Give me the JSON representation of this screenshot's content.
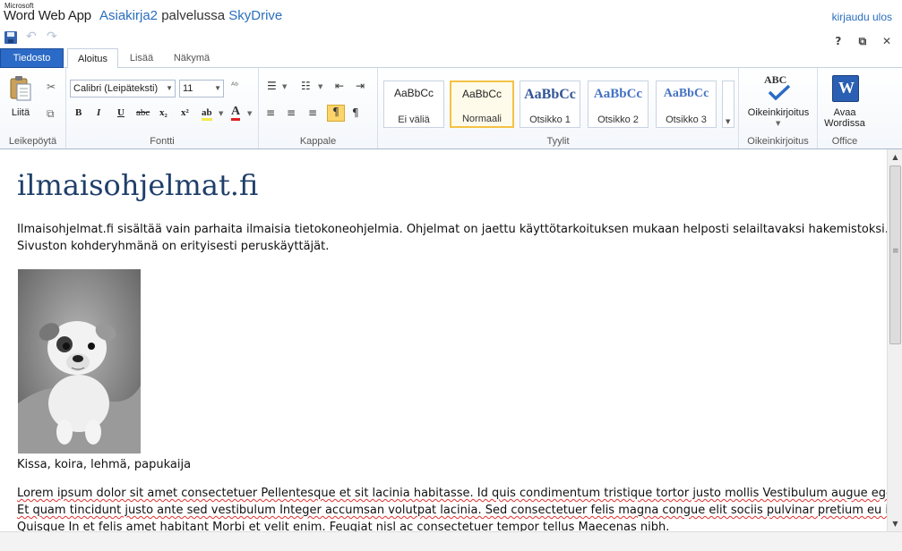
{
  "title_bar": {
    "brand_small": "Microsoft",
    "brand_main": "Word Web App",
    "doc_name": "Asiakirja2",
    "location_prefix": "palvelussa",
    "service": "SkyDrive",
    "signout": "kirjaudu ulos"
  },
  "quick_access": {
    "save_icon": "save-icon",
    "undo_icon": "undo-icon",
    "redo_icon": "redo-icon",
    "help": "?",
    "popout": "⧉",
    "close": "✕"
  },
  "tabs": {
    "file": "Tiedosto",
    "items": [
      "Aloitus",
      "Lisää",
      "Näkymä"
    ],
    "active": "Aloitus"
  },
  "ribbon": {
    "clipboard": {
      "label": "Leikepöytä",
      "paste": "Liitä"
    },
    "font": {
      "label": "Fontti",
      "font_name": "Calibri (Leipäteksti)",
      "font_size": "11",
      "bold": "B",
      "italic": "I",
      "underline": "U",
      "strike": "abc",
      "subscript": "x₂",
      "superscript": "x²",
      "highlight": "ab",
      "font_color": "A"
    },
    "paragraph": {
      "label": "Kappale"
    },
    "styles": {
      "label": "Tyylit",
      "sample": "AaBbCc",
      "items": [
        "Ei väliä",
        "Normaali",
        "Otsikko 1",
        "Otsikko 2",
        "Otsikko 3"
      ],
      "selected": "Normaali"
    },
    "proofing": {
      "label": "Oikeinkirjoitus",
      "button": "Oikeinkirjoitus",
      "icon_text": "ABC"
    },
    "office": {
      "label": "Office",
      "button_line1": "Avaa",
      "button_line2": "Wordissa"
    }
  },
  "document": {
    "heading": "ilmaisohjelmat.fi",
    "para1_line1": "Ilmaisohjelmat.fi sisältää vain parhaita ilmaisia tietokoneohjelmia. Ohjelmat on jaettu käyttötarkoituksen mukaan helposti selailtavaksi hakemistoksi.",
    "para1_line2": "Sivuston kohderyhmänä on erityisesti peruskäyttäjät.",
    "image": "puppy-photo",
    "caption": "Kissa, koira, lehmä, papukaija",
    "lorem_line1": "Lorem ipsum dolor sit amet consectetuer Pellentesque et sit lacinia habitasse. Id quis condimentum tristique tortor justo mollis Vestibulum augue eget Sed.",
    "lorem_line2": "Et quam tincidunt justo ante sed vestibulum Integer accumsan volutpat lacinia. Sed consectetuer felis magna congue elit sociis pulvinar pretium eu in. Pede",
    "lorem_line3": "Quisque In et felis amet habitant Morbi et velit enim. Feugiat nisl ac consectetuer tempor tellus Maecenas nibh."
  },
  "colors": {
    "accent": "#2b6ac6",
    "link": "#2a6ebd",
    "heading": "#1f3f6a",
    "style_selected": "#f3c246"
  }
}
